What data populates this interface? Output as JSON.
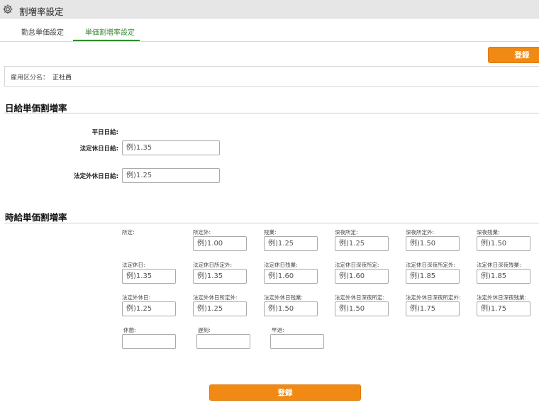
{
  "app": {
    "title": "割増率設定"
  },
  "tabs": [
    {
      "label": "勤怠単価設定"
    },
    {
      "label": "単価割増率設定"
    }
  ],
  "actions": {
    "register_label": "登録"
  },
  "employment": {
    "label": "雇用区分名：",
    "value": "正社員"
  },
  "daily": {
    "title": "日給単価割増率",
    "rows": [
      {
        "label": "平日日給:"
      },
      {
        "label": "法定休日日給:",
        "placeholder": "例)1.35"
      },
      {
        "label": "法定外休日日給:",
        "placeholder": "例)1.25"
      }
    ]
  },
  "hourly": {
    "title": "時給単価割増率",
    "rows": [
      [
        {
          "label": "所定:"
        },
        {
          "label": "所定外:",
          "placeholder": "例)1.00"
        },
        {
          "label": "残業:",
          "placeholder": "例)1.25"
        },
        {
          "label": "深夜所定:",
          "placeholder": "例)1.25"
        },
        {
          "label": "深夜所定外:",
          "placeholder": "例)1.50"
        },
        {
          "label": "深夜残業:",
          "placeholder": "例)1.50"
        }
      ],
      [
        {
          "label": "法定休日:",
          "placeholder": "例)1.35"
        },
        {
          "label": "法定休日所定外:",
          "placeholder": "例)1.35"
        },
        {
          "label": "法定休日残業:",
          "placeholder": "例)1.60"
        },
        {
          "label": "法定休日深夜所定:",
          "placeholder": "例)1.60"
        },
        {
          "label": "法定休日深夜所定外:",
          "placeholder": "例)1.85"
        },
        {
          "label": "法定休日深夜残業:",
          "placeholder": "例)1.85"
        }
      ],
      [
        {
          "label": "法定外休日:",
          "placeholder": "例)1.25"
        },
        {
          "label": "法定外休日所定外:",
          "placeholder": "例)1.25"
        },
        {
          "label": "法定外休日残業:",
          "placeholder": "例)1.50"
        },
        {
          "label": "法定外休日深夜所定:",
          "placeholder": "例)1.50"
        },
        {
          "label": "法定外休日深夜所定外:",
          "placeholder": "例)1.75"
        },
        {
          "label": "法定外休日深夜残業:",
          "placeholder": "例)1.75"
        }
      ]
    ],
    "extra": [
      {
        "label": "休憩:",
        "placeholder": ""
      },
      {
        "label": "遅刻:",
        "placeholder": ""
      },
      {
        "label": "早退:",
        "placeholder": ""
      }
    ]
  }
}
